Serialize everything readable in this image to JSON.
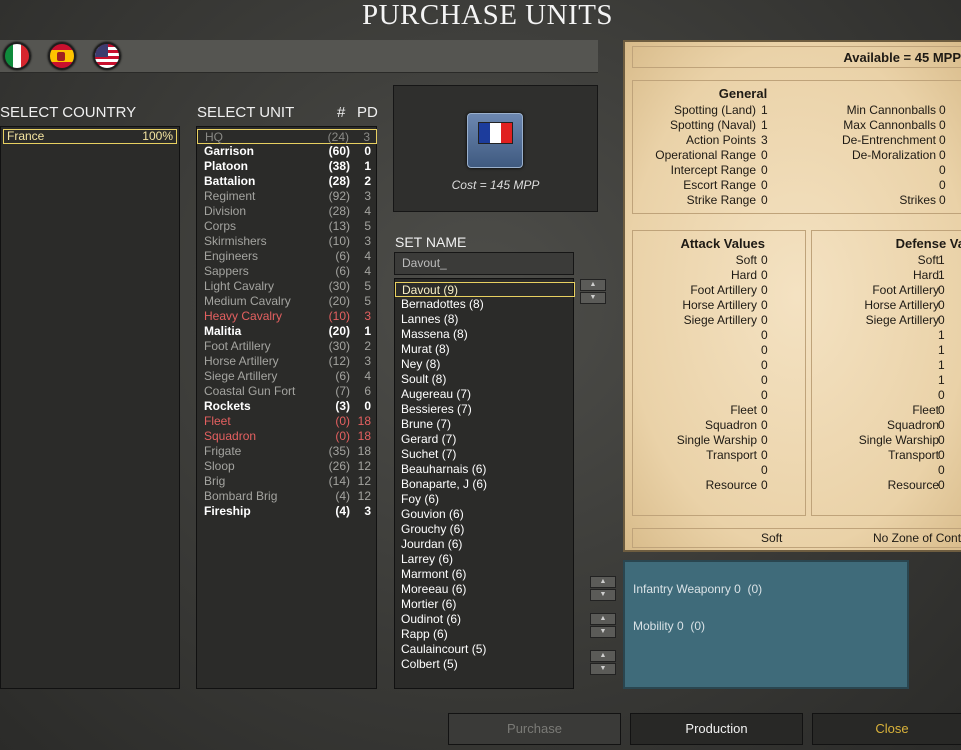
{
  "title": "PURCHASE UNITS",
  "flags": [
    "italy-flag-icon",
    "spain-flag-icon",
    "usa-flag-icon"
  ],
  "labels": {
    "select_country": "SELECT COUNTRY",
    "select_unit": "SELECT UNIT",
    "col_count": "#",
    "col_pd": "PD",
    "set_name": "SET NAME"
  },
  "country": {
    "name": "France",
    "percent": "100%"
  },
  "units": [
    {
      "name": "HQ",
      "count": "(24)",
      "pd": "3",
      "style": "sel"
    },
    {
      "name": "Garrison",
      "count": "(60)",
      "pd": "0",
      "style": "white"
    },
    {
      "name": "Platoon",
      "count": "(38)",
      "pd": "1",
      "style": "white"
    },
    {
      "name": "Battalion",
      "count": "(28)",
      "pd": "2",
      "style": "white"
    },
    {
      "name": "Regiment",
      "count": "(92)",
      "pd": "3",
      "style": "gray"
    },
    {
      "name": "Division",
      "count": "(28)",
      "pd": "4",
      "style": "gray"
    },
    {
      "name": "Corps",
      "count": "(13)",
      "pd": "5",
      "style": "gray"
    },
    {
      "name": "Skirmishers",
      "count": "(10)",
      "pd": "3",
      "style": "gray"
    },
    {
      "name": "Engineers",
      "count": "(6)",
      "pd": "4",
      "style": "gray"
    },
    {
      "name": "Sappers",
      "count": "(6)",
      "pd": "4",
      "style": "gray"
    },
    {
      "name": "Light Cavalry",
      "count": "(30)",
      "pd": "5",
      "style": "gray"
    },
    {
      "name": "Medium Cavalry",
      "count": "(20)",
      "pd": "5",
      "style": "gray"
    },
    {
      "name": "Heavy Cavalry",
      "count": "(10)",
      "pd": "3",
      "style": "red"
    },
    {
      "name": "Malitia",
      "count": "(20)",
      "pd": "1",
      "style": "white"
    },
    {
      "name": "Foot Artillery",
      "count": "(30)",
      "pd": "2",
      "style": "gray"
    },
    {
      "name": "Horse Artillery",
      "count": "(12)",
      "pd": "3",
      "style": "gray"
    },
    {
      "name": "Siege Artillery",
      "count": "(6)",
      "pd": "4",
      "style": "gray"
    },
    {
      "name": "Coastal Gun Fort",
      "count": "(7)",
      "pd": "6",
      "style": "gray"
    },
    {
      "name": "Rockets",
      "count": "(3)",
      "pd": "0",
      "style": "white"
    },
    {
      "name": "Fleet",
      "count": "(0)",
      "pd": "18",
      "style": "red"
    },
    {
      "name": "Squadron",
      "count": "(0)",
      "pd": "18",
      "style": "red"
    },
    {
      "name": "Frigate",
      "count": "(35)",
      "pd": "18",
      "style": "gray"
    },
    {
      "name": "Sloop",
      "count": "(26)",
      "pd": "12",
      "style": "gray"
    },
    {
      "name": "Brig",
      "count": "(14)",
      "pd": "12",
      "style": "gray"
    },
    {
      "name": "Bombard Brig",
      "count": "(4)",
      "pd": "12",
      "style": "gray"
    },
    {
      "name": "Fireship",
      "count": "(4)",
      "pd": "3",
      "style": "white"
    }
  ],
  "preview": {
    "cost": "Cost = 145 MPP",
    "icon": "french-flag-unit-icon"
  },
  "set_name_value": "Davout_",
  "set_names": [
    "Davout (9)",
    "Bernadottes (8)",
    "Lannes (8)",
    "Massena (8)",
    "Murat (8)",
    "Ney (8)",
    "Soult (8)",
    "Augereau (7)",
    "Bessieres (7)",
    "Brune (7)",
    "Gerard (7)",
    "Suchet (7)",
    "Beauharnais (6)",
    "Bonaparte, J (6)",
    "Foy (6)",
    "Gouvion (6)",
    "Grouchy (6)",
    "Jourdan (6)",
    "Larrey (6)",
    "Marmont (6)",
    "Moreeau (6)",
    "Mortier (6)",
    "Oudinot (6)",
    "Rapp (6)",
    "Caulaincourt (5)",
    "Colbert (5)"
  ],
  "available": "Available = 45 MPP",
  "general": {
    "header": "General",
    "left": [
      {
        "label": "Spotting (Land)",
        "value": "1"
      },
      {
        "label": "Spotting (Naval)",
        "value": "1"
      },
      {
        "label": "Action Points",
        "value": "3"
      },
      {
        "label": "Operational Range",
        "value": "0"
      },
      {
        "label": "Intercept Range",
        "value": "0"
      },
      {
        "label": "Escort Range",
        "value": "0"
      },
      {
        "label": "Strike Range",
        "value": "0"
      }
    ],
    "right": [
      {
        "label": "Min Cannonballs",
        "value": "0"
      },
      {
        "label": "Max Cannonballs",
        "value": "0"
      },
      {
        "label": "De-Entrenchment",
        "value": "0"
      },
      {
        "label": "De-Moralization",
        "value": "0"
      },
      {
        "label": "",
        "value": "0"
      },
      {
        "label": "",
        "value": "0"
      },
      {
        "label": "Strikes",
        "value": "0"
      }
    ]
  },
  "attack": {
    "header": "Attack Values",
    "rows": [
      {
        "label": "Soft",
        "value": "0"
      },
      {
        "label": "Hard",
        "value": "0"
      },
      {
        "label": "Foot Artillery",
        "value": "0"
      },
      {
        "label": "Horse Artillery",
        "value": "0"
      },
      {
        "label": "Siege Artillery",
        "value": "0"
      },
      {
        "label": "",
        "value": "0"
      },
      {
        "label": "",
        "value": "0"
      },
      {
        "label": "",
        "value": "0"
      },
      {
        "label": "",
        "value": "0"
      },
      {
        "label": "",
        "value": "0"
      },
      {
        "label": "Fleet",
        "value": "0"
      },
      {
        "label": "Squadron",
        "value": "0"
      },
      {
        "label": "Single Warship",
        "value": "0"
      },
      {
        "label": "Transport",
        "value": "0"
      },
      {
        "label": "",
        "value": "0"
      },
      {
        "label": "Resource",
        "value": "0"
      }
    ]
  },
  "defense": {
    "header": "Defense Values",
    "rows": [
      {
        "label": "Soft",
        "value": "1"
      },
      {
        "label": "Hard",
        "value": "1"
      },
      {
        "label": "Foot Artillery",
        "value": "0"
      },
      {
        "label": "Horse Artillery",
        "value": "0"
      },
      {
        "label": "Siege Artillery",
        "value": "0"
      },
      {
        "label": "",
        "value": "1"
      },
      {
        "label": "",
        "value": "1"
      },
      {
        "label": "",
        "value": "1"
      },
      {
        "label": "",
        "value": "1"
      },
      {
        "label": "",
        "value": "0"
      },
      {
        "label": "Fleet",
        "value": "0"
      },
      {
        "label": "Squadron",
        "value": "0"
      },
      {
        "label": "Single Warship",
        "value": "0"
      },
      {
        "label": "Transport",
        "value": "0"
      },
      {
        "label": "",
        "value": "0"
      },
      {
        "label": "Resource",
        "value": "0"
      }
    ]
  },
  "footer": {
    "left": "Soft",
    "right": "No Zone of Cont"
  },
  "upgrades": [
    {
      "label": "Infantry Weaponry 0",
      "value": "(0)"
    },
    {
      "label": "Mobility 0",
      "value": "(0)"
    }
  ],
  "buttons": {
    "purchase": "Purchase",
    "production": "Production",
    "close": "Close"
  },
  "colors": {
    "close": "#d9b23a",
    "disabled": "#7a7a76",
    "highlight": "#e8d060"
  }
}
